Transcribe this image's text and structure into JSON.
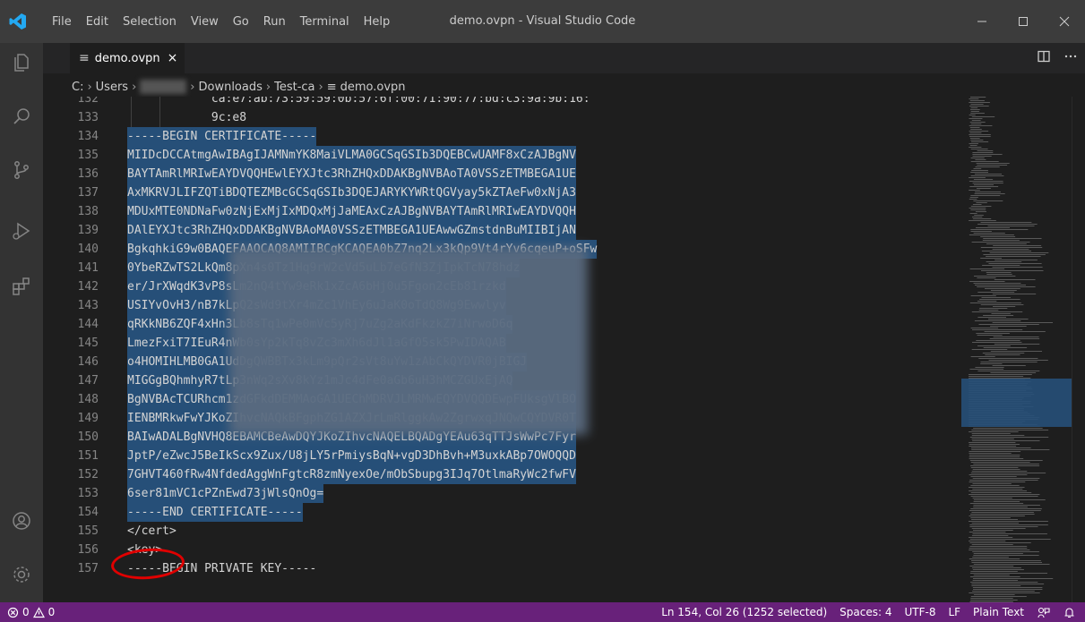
{
  "app": {
    "window_title": "demo.ovpn - Visual Studio Code",
    "menu": [
      "File",
      "Edit",
      "Selection",
      "View",
      "Go",
      "Run",
      "Terminal",
      "Help"
    ]
  },
  "tab": {
    "label": "demo.ovpn",
    "close": "×"
  },
  "breadcrumbs": [
    "C:",
    "Users",
    "Downloads",
    "Test-ca",
    "demo.ovpn"
  ],
  "editor": {
    "lines": [
      {
        "n": "132",
        "text": "            ca:e7:ab:73:59:59:0b:57:6f:00:71:90:77:bd:c3:9a:9b:16:"
      },
      {
        "n": "133",
        "text": "            9c:e8"
      },
      {
        "n": "134",
        "text": "-----BEGIN CERTIFICATE-----"
      },
      {
        "n": "135",
        "text": "MIIDcDCCAtmgAwIBAgIJAMNmYK8MaiVLMA0GCSqGSIb3DQEBCwUAMF8xCzAJBgNV"
      },
      {
        "n": "136",
        "text": "BAYTAmRlMRIwEAYDVQQHEwlEYXJtc3RhZHQxDDAKBgNVBAoTA0VSSzETMBEGA1UE"
      },
      {
        "n": "137",
        "text": "AxMKRVJLIFZQTiBDQTEZMBcGCSqGSIb3DQEJARYKYWRtQGVyay5kZTAeFw0xNjA3"
      },
      {
        "n": "138",
        "text": "MDUxMTE0NDNaFw0zNjExMjIxMDQxMjJaMEAxCzAJBgNVBAYTAmRlMRIwEAYDVQQH"
      },
      {
        "n": "139",
        "text": "DAlEYXJtc3RhZHQxDDAKBgNVBAoMA0VSSzETMBEGA1UEAwwGZmstdnBuMIIBIjAN"
      },
      {
        "n": "140",
        "text": "BgkqhkiG9w0BAQEFAAOCAQ8AMIIBCgKCAQEA0bZ7nq2Lx3kQp9Vt4rYv6cqeuP+oSFw"
      },
      {
        "n": "141",
        "text": "0YbeRZwTS2LkQm8pXn4s0Tz1Hq9rW2cVd5uLb7eGfN3ZjIpkTcN78hdz"
      },
      {
        "n": "142",
        "text": "er/JrXWqdK3vP8sLm2nQ4tYw9eRk1xZcA6bHj0u5Fgon2cEb81rzkd"
      },
      {
        "n": "143",
        "text": "USIYvOvH3/nB7kLpQ2sWd9tXr4mZc1VhEy6uJaK0oTdQ8Wg9Ewwlyv"
      },
      {
        "n": "144",
        "text": "qRKkNB6ZQF4xHn3Lb8sTq1wPe0mVc5yRj7uZg2aKdFkzkZ7iNrwoD6q"
      },
      {
        "n": "145",
        "text": "LmezFxiT7IEuR4nWb0sYp2kTq8vZc3mXh6dJl1aGfO5sk5PwIDAQAB"
      },
      {
        "n": "146",
        "text": "o4HOMIHLMB0GA1UdDgQWBBTx3kLm9pQr2sVt8uYw1zAbCkQYDVR0jBIGJ"
      },
      {
        "n": "147",
        "text": "MIGGgBQhmhyR7tLp3nWq2sXv8kYz1mJc4dFe0aGb6uH3hMCZGUxEjAQ"
      },
      {
        "n": "148",
        "text": "BgNVBAcTCURhcm1zdGFkdDEMMAoGA1UEChMDRVJLMRMwEQYDVQQDEwpFUksgVlBO"
      },
      {
        "n": "149",
        "text": "IENBMRkwFwYJKoZIhvcNAQkBFgphZG1AZXJrLmRlggkAw2ZgrwxqJNQwCQYDVR0T"
      },
      {
        "n": "150",
        "text": "BAIwADALBgNVHQ8EBAMCBeAwDQYJKoZIhvcNAQELBQADgYEAu63qTTJsWwPc7Fyr"
      },
      {
        "n": "151",
        "text": "JptP/eZwcJ5BeIkScx9Zux/U8jLY5rPmiysBqN+vgD3DhBvh+M3uxkABp7OWOQQD"
      },
      {
        "n": "152",
        "text": "7GHVT460fRw4NfdedAggWnFgtcR8zmNyexOe/mObSbupg3IJq7OtlmaRyWc2fwFV"
      },
      {
        "n": "153",
        "text": "6ser81mVC1cPZnEwd73jWlsQnOg="
      },
      {
        "n": "154",
        "text": "-----END CERTIFICATE-----"
      },
      {
        "n": "155",
        "text": "</cert>"
      },
      {
        "n": "156",
        "text": "<key>"
      },
      {
        "n": "157",
        "text": "-----BEGIN PRIVATE KEY-----"
      }
    ]
  },
  "status": {
    "errors": "0",
    "warnings": "0",
    "position": "Ln 154, Col 26 (1252 selected)",
    "spaces": "Spaces: 4",
    "encoding": "UTF-8",
    "eol": "LF",
    "language": "Plain Text"
  },
  "colors": {
    "accent_status": "#68217a",
    "selection": "#264f78",
    "annotation_circle": "#e00000"
  }
}
